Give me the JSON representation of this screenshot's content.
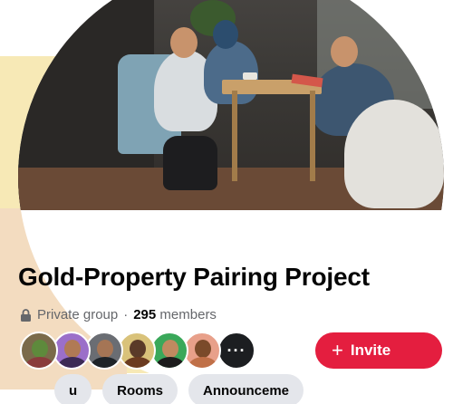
{
  "group": {
    "name": "Gold-Property Pairing Project",
    "privacy": "Private group",
    "separator": "·",
    "member_count": "295",
    "members_label": "members"
  },
  "members": {
    "more_label": "···"
  },
  "actions": {
    "invite_label": "Invite",
    "invite_icon": "+",
    "invite_color": "#e41e3f"
  },
  "tabs": [
    {
      "label": "u"
    },
    {
      "label": "Rooms"
    },
    {
      "label": "Announceme"
    }
  ],
  "colors": {
    "backdrop": "#f7e9b6",
    "title_text": "#050505",
    "meta_text": "#65676b",
    "tab_bg": "#e4e6eb"
  },
  "icons": {
    "privacy": "lock-icon",
    "add": "plus-icon",
    "more": "more-dots-icon"
  }
}
